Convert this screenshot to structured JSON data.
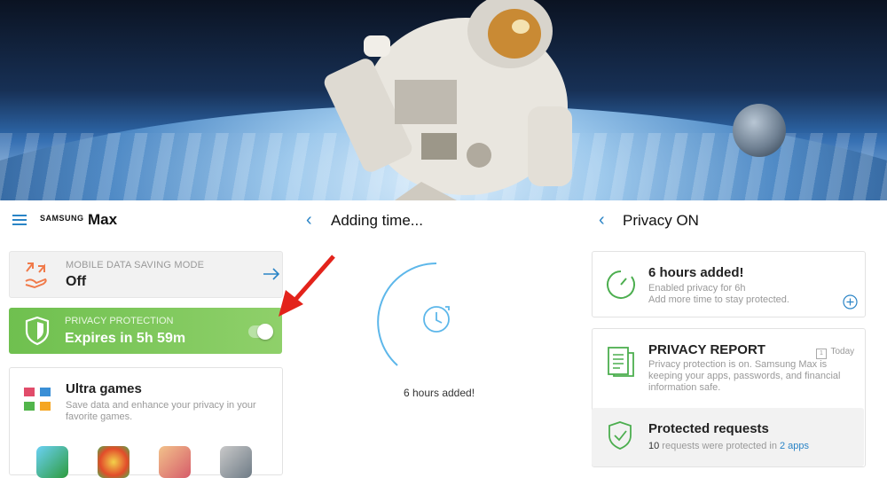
{
  "panel1": {
    "brand_small": "SAMSUNG",
    "brand_big": "Max",
    "data_saving": {
      "label": "MOBILE DATA SAVING MODE",
      "value": "Off"
    },
    "privacy": {
      "label": "PRIVACY PROTECTION",
      "value": "Expires in 5h 59m",
      "toggle_on": true
    },
    "ultra": {
      "title": "Ultra games",
      "desc": "Save data and enhance your privacy in your favorite games."
    }
  },
  "panel2": {
    "title": "Adding time...",
    "status": "6 hours added!"
  },
  "panel3": {
    "title": "Privacy ON",
    "added": {
      "title": "6 hours added!",
      "line1": "Enabled privacy for 6h",
      "line2": "Add more time to stay protected."
    },
    "report": {
      "title": "PRIVACY REPORT",
      "badge": "Today",
      "badge_num": "1",
      "desc": "Privacy protection is on. Samsung Max is keeping your apps, passwords, and financial information safe."
    },
    "protected": {
      "title": "Protected requests",
      "count": "10",
      "text": " requests were protected in ",
      "apps": "2 apps"
    }
  },
  "colors": {
    "accent": "#2a84c6",
    "green": "#6fc04f",
    "arrow": "#e3231b",
    "orange": "#f07a4a"
  }
}
